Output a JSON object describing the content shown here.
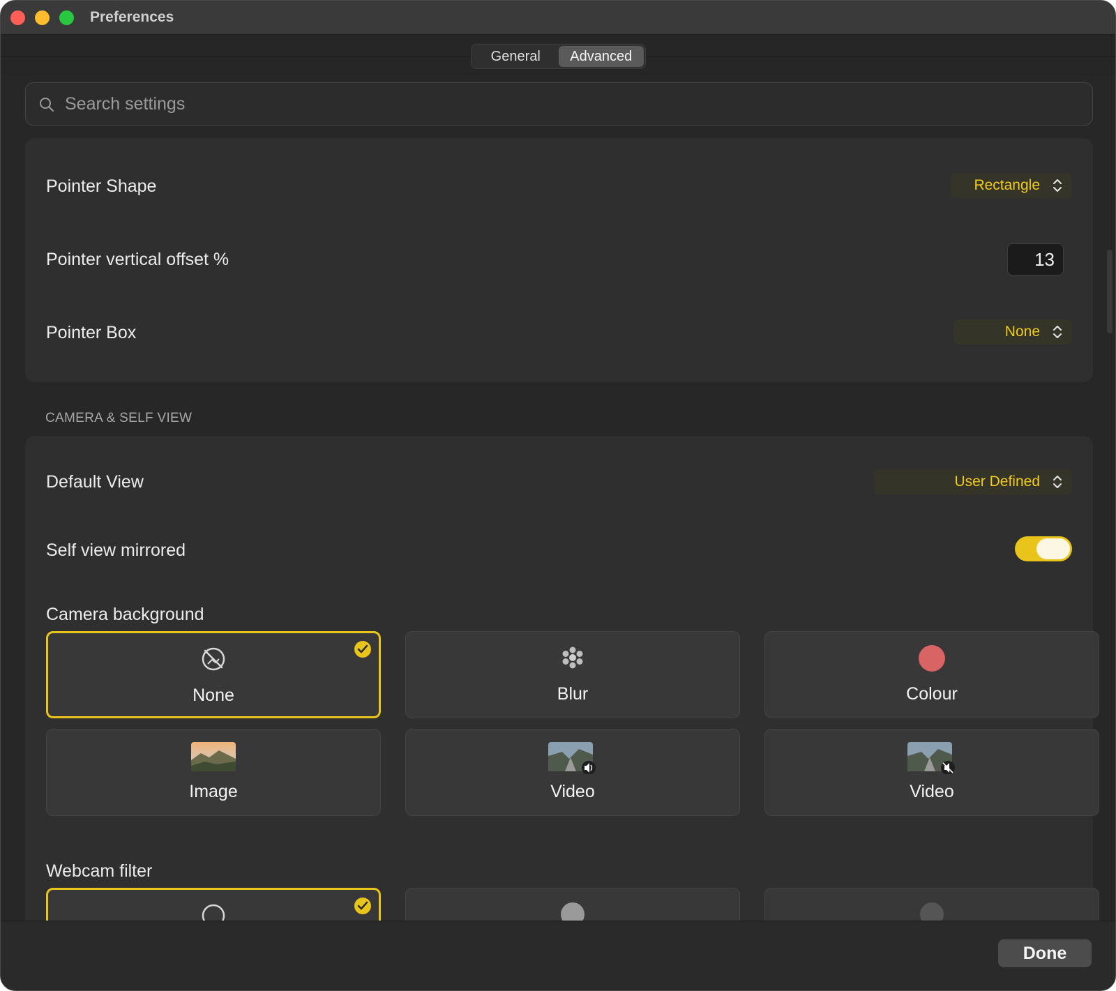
{
  "window": {
    "title": "Preferences"
  },
  "tabs": [
    {
      "label": "General",
      "active": false
    },
    {
      "label": "Advanced",
      "active": true
    }
  ],
  "search": {
    "placeholder": "Search settings",
    "value": ""
  },
  "pointer": {
    "shape": {
      "label": "Pointer Shape",
      "value": "Rectangle"
    },
    "offset": {
      "label": "Pointer vertical offset %",
      "value": "13"
    },
    "box": {
      "label": "Pointer Box",
      "value": "None"
    }
  },
  "camera_section": {
    "header": "CAMERA & SELF VIEW",
    "default_view": {
      "label": "Default View",
      "value": "User Defined"
    },
    "mirrored": {
      "label": "Self view mirrored",
      "on": true
    },
    "background": {
      "label": "Camera background",
      "options": [
        {
          "label": "None",
          "icon": "no-background-icon",
          "selected": true
        },
        {
          "label": "Blur",
          "icon": "blur-icon",
          "selected": false
        },
        {
          "label": "Colour",
          "icon": "colour-swatch-icon",
          "selected": false
        },
        {
          "label": "Image",
          "icon": "landscape-image-icon",
          "selected": false
        },
        {
          "label": "Video",
          "icon": "video-sound-icon",
          "selected": false
        },
        {
          "label": "Video",
          "icon": "video-muted-icon",
          "selected": false
        }
      ]
    },
    "webcam_filter": {
      "label": "Webcam filter"
    }
  },
  "footer": {
    "done_label": "Done"
  },
  "colors": {
    "accent": "#e9c41b",
    "swatch": "#d96464"
  }
}
